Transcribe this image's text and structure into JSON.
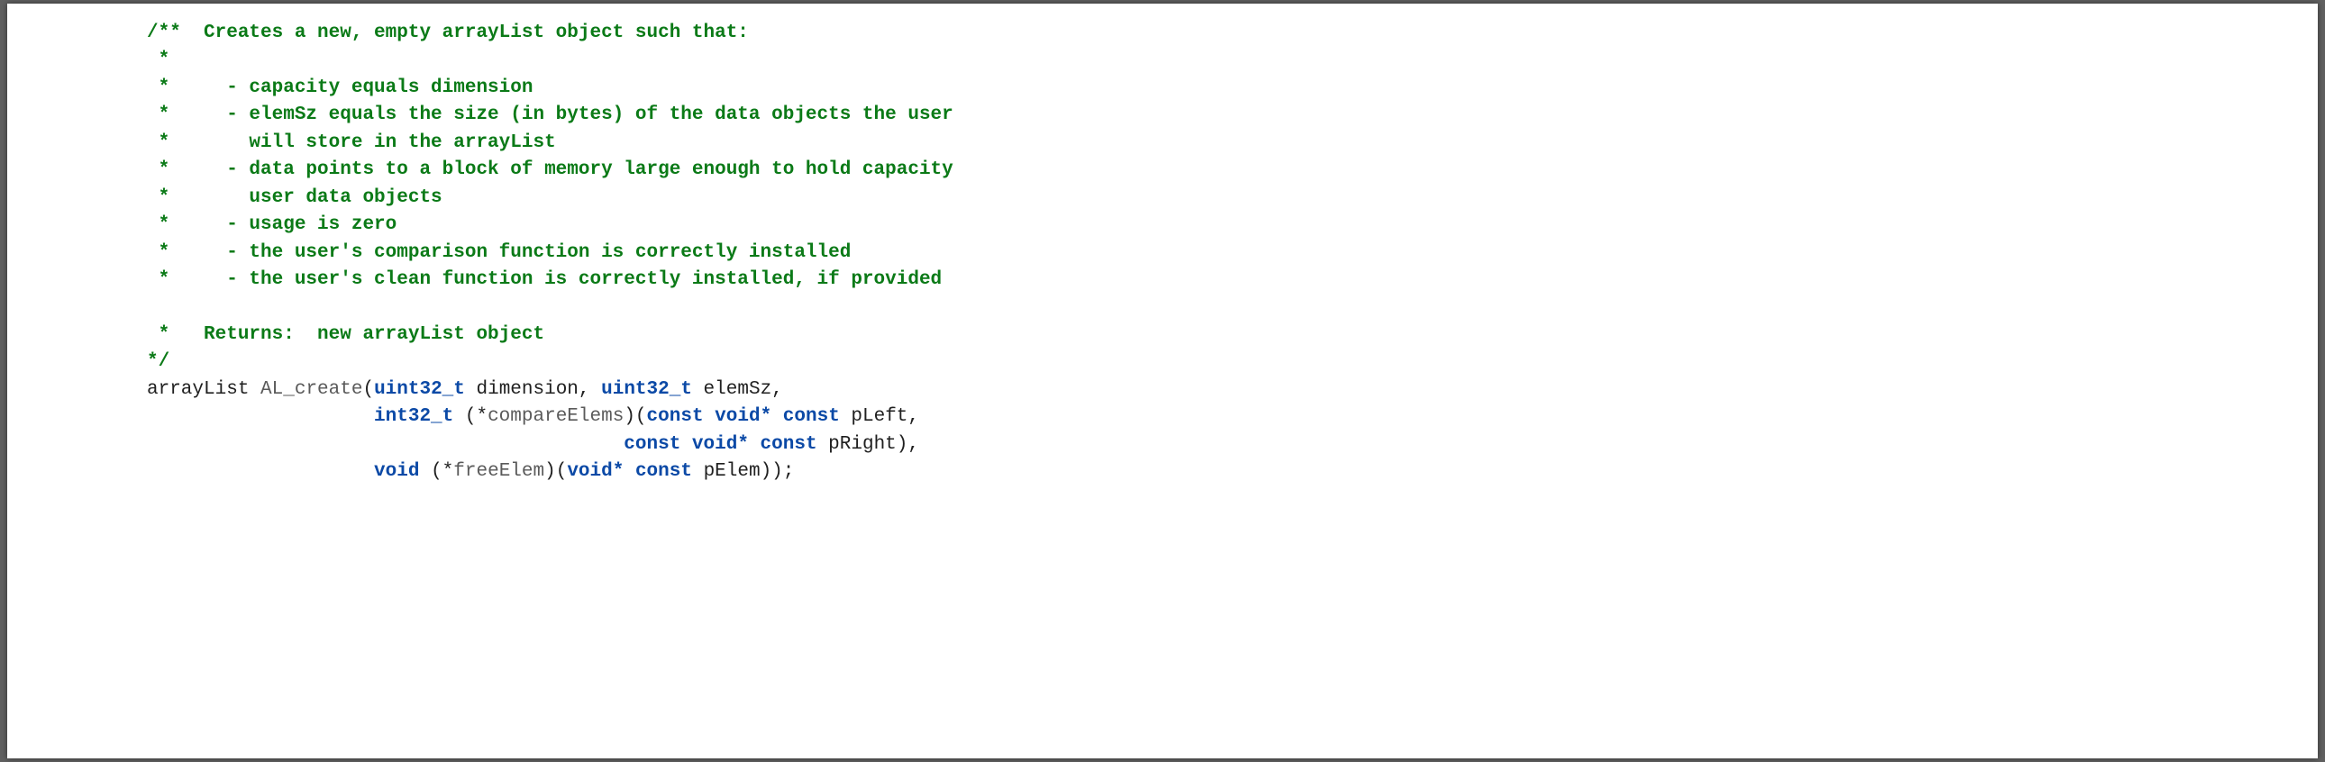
{
  "comment": {
    "l1": "/**  Creates a new, empty arrayList object such that:",
    "l2": " *",
    "l3": " *     - capacity equals dimension",
    "l4": " *     - elemSz equals the size (in bytes) of the data objects the user",
    "l5": " *       will store in the arrayList",
    "l6": " *     - data points to a block of memory large enough to hold capacity",
    "l7": " *       user data objects",
    "l8": " *     - usage is zero",
    "l9": " *     - the user's comparison function is correctly installed",
    "l10": " *     - the user's clean function is correctly installed, if provided",
    "blank": "",
    "l11": " *   Returns:  new arrayList object",
    "l12": "*/"
  },
  "code": {
    "type_uint32": "uint32_t",
    "type_int32": "int32_t",
    "kw_const": "const",
    "kw_void": "void",
    "kw_voidp": "void*",
    "fn_name": "AL_create",
    "ret_type": "arrayList ",
    "p_dim": " dimension, ",
    "p_elemsz": " elemSz,",
    "indent2": "                    ",
    "cmp_open": " (*",
    "cmp_name": "compareElems",
    "cmp_close_open": ")(",
    "p_left": " pLeft,",
    "indent3": "                                          ",
    "p_right": " pRight),",
    "free_open": " (*",
    "free_name": "freeElem",
    "free_close_open": ")(",
    "p_elem": " pElem));"
  }
}
